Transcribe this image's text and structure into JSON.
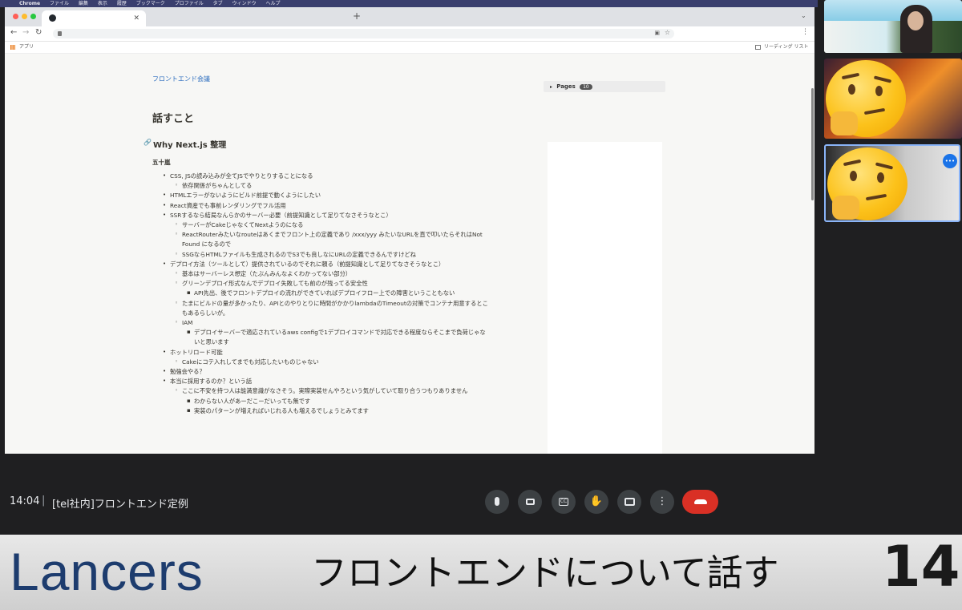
{
  "menubar": {
    "items": [
      "Chrome",
      "ファイル",
      "編集",
      "表示",
      "履歴",
      "ブックマーク",
      "プロファイル",
      "タブ",
      "ウィンドウ",
      "ヘルプ"
    ]
  },
  "browser": {
    "tab_icon": "github-icon",
    "new_tab": "+",
    "bookmarks": {
      "apps": "アプリ",
      "reading_list": "リーディング リスト"
    }
  },
  "doc": {
    "breadcrumb": "フロントエンド会議",
    "title": "話すこと",
    "section": "Why Next.js 整理",
    "author": "五十嵐",
    "items": [
      {
        "level": 1,
        "text": "CSS, JSの読み込みが全てJSでやりとりすることになる"
      },
      {
        "level": 2,
        "text": "依存関係がちゃんとしてる"
      },
      {
        "level": 1,
        "text": "HTMLエラーがないようにビルド前提で動くようにしたい"
      },
      {
        "level": 1,
        "text": "React資産でも事前レンダリングでフル活用"
      },
      {
        "level": 1,
        "text": "SSRするなら結局なんらかのサーバー必要（前提知識として足りてなさそうなとこ）"
      },
      {
        "level": 2,
        "text": "サーバーがCakeじゃなくてNextようのになる"
      },
      {
        "level": 2,
        "text": "ReactRouterみたいなrouteはあくまでフロント上の定義であり /xxx/yyy みたいなURLを直で叩いたらそれはNot"
      },
      {
        "level": 0,
        "text": "Found になるので"
      },
      {
        "level": 2,
        "text": "SSGならHTMLファイルも生成されるのでS3でも良しなにURLの定義できるんですけどね"
      },
      {
        "level": 1,
        "text": "デプロイ方法（ツールとして）提供されているのでそれに頼る（前提知識として足りてなさそうなとこ）"
      },
      {
        "level": 2,
        "text": "基本はサーバーレス想定（たぶんみんなよくわかってない部分）"
      },
      {
        "level": 2,
        "text": "グリーンデプロイ形式なんでデプロイ失敗しても前のが残ってる安全性"
      },
      {
        "level": 3,
        "text": "API先出、後でフロントデプロイの流れができていればデプロイフロー上での障害ということもない"
      },
      {
        "level": 2,
        "text": "たまにビルドの量が多かったり、APIとのやりとりに時間がかかりlambdaのTimeoutの対策でコンテナ用意するとこ"
      },
      {
        "level": 0,
        "text": "もあるらしいが。"
      },
      {
        "level": 2,
        "text": "IAM"
      },
      {
        "level": 3,
        "text": "デプロイサーバーで適応されているaws configで1デプロイコマンドで対応できる程度ならそこまで負荷じゃな"
      },
      {
        "level": 0,
        "text": "いと思います"
      },
      {
        "level": 1,
        "text": "ホットリロード可能"
      },
      {
        "level": 2,
        "text": "Cakeにコテ入れしてまでも対応したいものじゃない"
      },
      {
        "level": 1,
        "text": "勉強会やる？"
      },
      {
        "level": 1,
        "text": "本当に採用するのか？という話"
      },
      {
        "level": 2,
        "text": "ここに不安を持つ人は能満意識がなさそう。実際実装せんやろという気がしていて取り合うつもりありません"
      },
      {
        "level": 3,
        "text": "わからない人があーだこーだいっても無です"
      },
      {
        "level": 3,
        "text": "実装のパターンが増えればいじれる人も増えるでしょうとみてます"
      }
    ]
  },
  "pages_panel": {
    "label": "Pages",
    "count": "10"
  },
  "meeting": {
    "time": "14:04",
    "separator": "|",
    "title": "[tel社内]フロントエンド定例",
    "buttons": [
      {
        "name": "microphone-icon",
        "glyph": "🎙"
      },
      {
        "name": "camera-icon",
        "glyph": "▭"
      },
      {
        "name": "captions-icon",
        "glyph": "CC"
      },
      {
        "name": "raise-hand-icon",
        "glyph": "✋"
      },
      {
        "name": "present-screen-icon",
        "glyph": "⬆"
      },
      {
        "name": "more-options-icon",
        "glyph": "⋮"
      }
    ],
    "end_call_glyph": "☎",
    "tile_more": "•••"
  },
  "banner": {
    "logo": "Lancers",
    "headline": "フロントエンドについて話す",
    "episode": "14"
  },
  "colors": {
    "meet_bg": "#202124",
    "end_call": "#d93025",
    "active_tile_border": "#8ab4f8",
    "lancers_logo": "#1d3c6e"
  }
}
